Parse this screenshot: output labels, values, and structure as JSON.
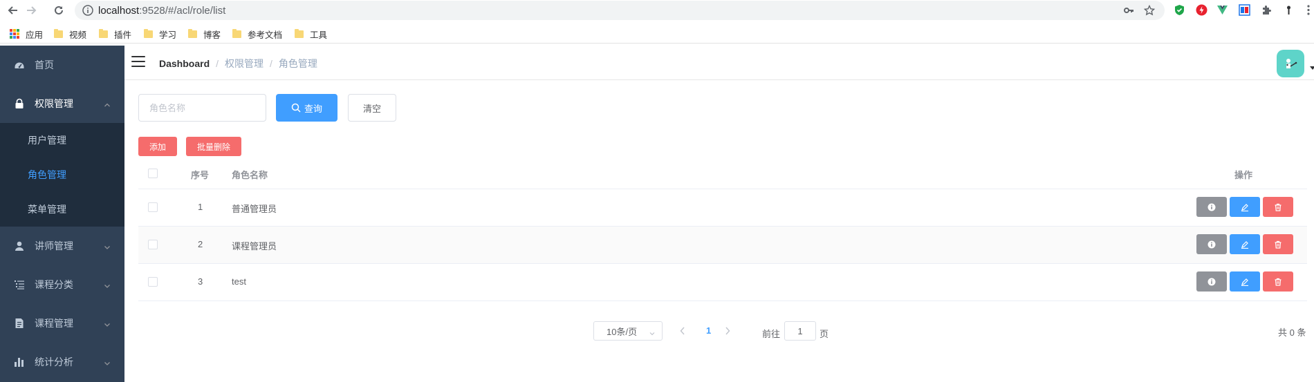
{
  "browser": {
    "url_host": "localhost",
    "url_rest": ":9528/#/acl/role/list",
    "bookmarks": [
      "应用",
      "视频",
      "插件",
      "学习",
      "博客",
      "参考文档",
      "工具"
    ]
  },
  "sidebar": {
    "items": [
      {
        "label": "首页",
        "icon": "dashboard-icon"
      },
      {
        "label": "权限管理",
        "icon": "lock-icon",
        "expanded": true
      },
      {
        "label": "讲师管理",
        "icon": "user-icon"
      },
      {
        "label": "课程分类",
        "icon": "list-icon"
      },
      {
        "label": "课程管理",
        "icon": "document-icon"
      },
      {
        "label": "统计分析",
        "icon": "chart-icon"
      }
    ],
    "subitems": [
      "用户管理",
      "角色管理",
      "菜单管理"
    ],
    "active_subitem": "角色管理"
  },
  "navbar": {
    "breadcrumb": [
      "Dashboard",
      "权限管理",
      "角色管理"
    ]
  },
  "search": {
    "placeholder": "角色名称",
    "value": "",
    "query_label": "查询",
    "clear_label": "清空"
  },
  "toolbar": {
    "add_label": "添加",
    "batch_delete_label": "批量删除"
  },
  "table": {
    "headers": {
      "index": "序号",
      "name": "角色名称",
      "actions": "操作"
    },
    "rows": [
      {
        "index": "1",
        "name": "普通管理员"
      },
      {
        "index": "2",
        "name": "课程管理员"
      },
      {
        "index": "3",
        "name": "test"
      }
    ]
  },
  "pagination": {
    "page_size": "10条/页",
    "current_page": "1",
    "goto_label": "前往",
    "goto_value": "1",
    "page_suffix": "页",
    "total_text": "共 0 条"
  },
  "colors": {
    "sidebar_bg": "#304156",
    "submenu_bg": "#1f2d3d",
    "primary": "#409eff",
    "danger": "#f56c6c",
    "info": "#909399",
    "avatar_bg": "#5ed4c9"
  }
}
